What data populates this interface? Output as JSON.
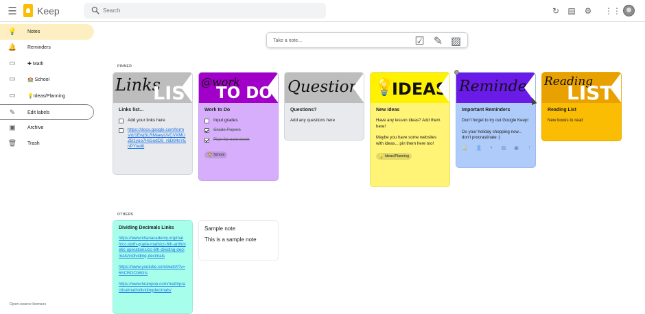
{
  "app": {
    "title": "Keep"
  },
  "search": {
    "placeholder": "Search"
  },
  "sidebar": {
    "items": [
      {
        "label": "Notes",
        "icon": "lightbulb-icon"
      },
      {
        "label": "Reminders",
        "icon": "bell-icon"
      },
      {
        "label": "Math",
        "icon": "plus-icon"
      },
      {
        "label": "School",
        "icon": "school-icon"
      },
      {
        "label": "Ideas/Planning",
        "icon": "lightbulb-icon"
      },
      {
        "label": "Edit labels",
        "icon": "pencil-icon"
      },
      {
        "label": "Archive",
        "icon": "archive-icon"
      },
      {
        "label": "Trash",
        "icon": "trash-icon"
      }
    ]
  },
  "take_note": {
    "placeholder": "Take a note..."
  },
  "sections": {
    "pinned": "PINNED",
    "others": "OTHERS"
  },
  "notes": {
    "links": {
      "banner_line1": "Links",
      "banner_line2": "LIST",
      "title": "Links list...",
      "items": [
        {
          "text": "Add your links here",
          "checked": false
        },
        {
          "text": "https://docs.google.com/forms/d/1EwjSLRMaeyUVCVXMUZB1yuo7HiGodDS_r6D84sYEnPY/edit",
          "checked": false
        }
      ]
    },
    "todo": {
      "banner_line1": "@work",
      "banner_line2": "TO DO",
      "title": "Work to Do",
      "items": [
        {
          "text": "Input grades",
          "checked": false
        },
        {
          "text": "Grade Papers",
          "checked": true
        },
        {
          "text": "Plan for next week",
          "checked": true
        }
      ],
      "label": "School"
    },
    "questions": {
      "banner": "Questions",
      "title": "Questions?",
      "body": "Add any questions here"
    },
    "ideas": {
      "banner": "IDEAS",
      "title": "New ideas",
      "body1": "Have any lesson ideas? Add them here!",
      "body2": "Maybe you have some websites with ideas... pin them here too!",
      "label": "Ideas/Planning"
    },
    "reminders": {
      "banner": "Reminders",
      "title": "Important Reminders",
      "body1": "Don't forget to try out Google Keep!",
      "body2": "Do your holiday shopping now... don't procrastinate :)"
    },
    "reading": {
      "banner_line1": "Reading",
      "banner_line2": "LIST",
      "title": "Reading List",
      "body": "New books to read"
    },
    "decimals": {
      "title": "Dividing Decimals Links",
      "links": [
        "https://www.khanacademy.org/math/cc-sixth-grade-math/cc-6th-arithmetic-operations/cc-6th-dividing-decimals/v/dividing-decimals",
        "https://www.youtube.com/watch?v=6SCROCb5Gts",
        "https://www.brainpop.com/math/practicalmath/dividingdecimals/"
      ]
    },
    "sample": {
      "title": "Sample note",
      "body": "This is a sample note"
    }
  },
  "footer": {
    "licenses": "Open-source licenses"
  },
  "colors": {
    "note_gray": "#e8eaed",
    "note_purple": "#d7aefb",
    "note_yellow": "#fff475",
    "note_blue": "#aecbfa",
    "note_orange": "#fbbc04",
    "note_teal": "#a7ffeb",
    "active": "#feefc3"
  }
}
